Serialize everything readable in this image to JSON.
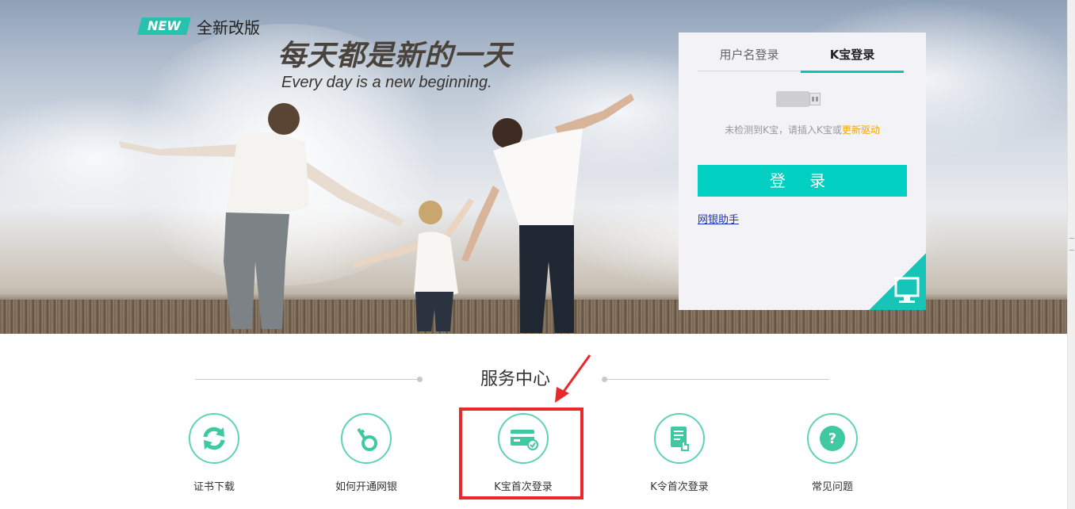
{
  "hero": {
    "badge": "NEW",
    "badge_caption": "全新改版",
    "slogan_cn": "每天都是新的一天",
    "slogan_en": "Every day is a new beginning."
  },
  "login": {
    "tabs": [
      {
        "label": "用户名登录",
        "active": false
      },
      {
        "label": "K宝登录",
        "active": true
      }
    ],
    "notice_text": "未检测到K宝，请插入K宝或",
    "notice_link": "更新驱动",
    "login_button": "登 录",
    "helper_link": "网银助手",
    "accent_color": "#00cfc2"
  },
  "service": {
    "title": "服务中心",
    "items": [
      {
        "label": "证书下载",
        "icon": "refresh-icon"
      },
      {
        "label": "如何开通网银",
        "icon": "key-icon"
      },
      {
        "label": "K宝首次登录",
        "icon": "card-icon"
      },
      {
        "label": "K令首次登录",
        "icon": "token-document-icon"
      },
      {
        "label": "常见问题",
        "icon": "question-icon"
      }
    ],
    "highlighted_item": "K宝首次登录"
  }
}
